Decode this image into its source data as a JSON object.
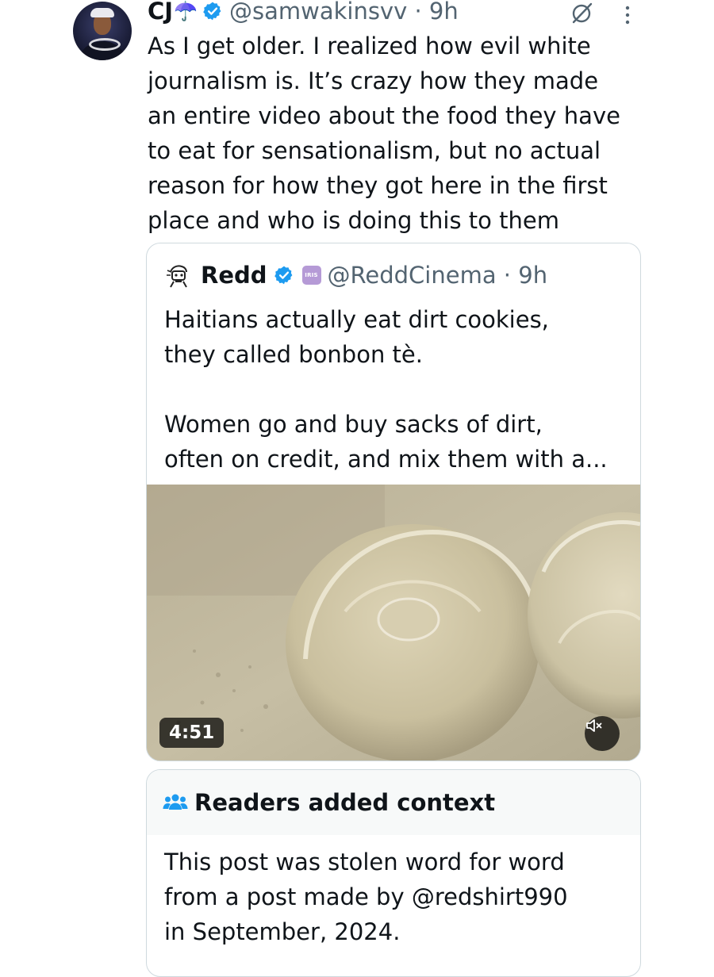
{
  "post": {
    "display_name": "CJ",
    "name_emoji": "☂️",
    "handle_time": "@samwakinsvv · 9h",
    "text_lines": [
      "As I get older. I realized how evil white",
      "journalism is. It’s crazy how they made",
      "an entire video about the food they have",
      "to eat for sensationalism, but no actual",
      "reason for how they got here in the first",
      "place and who is doing this to them"
    ],
    "icons": [
      "avatar",
      "verified-badge-icon",
      "grok-icon",
      "more-options-icon"
    ]
  },
  "quote": {
    "display_name": "Redd",
    "affiliate_badge": "IRIS",
    "handle_time": "@ReddCinema · 9h",
    "text_lines": [
      "Haitians actually eat dirt cookies,",
      "they called bonbon tè.",
      "",
      "Women go and buy sacks of dirt,",
      "often on credit, and mix them with a..."
    ],
    "video": {
      "duration": "4:51",
      "icons": [
        "mute-icon"
      ]
    }
  },
  "community_note": {
    "title": "Readers added context",
    "text_lines": [
      "This post was stolen word for word",
      "from a post made by @redshirt990",
      "in September, 2024."
    ]
  },
  "colors": {
    "text": "#0f1419",
    "secondary": "#536471",
    "verified": "#1d9bf0",
    "border": "#cfd9de",
    "note_header_bg": "#f7f9f9",
    "note_icon": "#1d9bf0"
  }
}
